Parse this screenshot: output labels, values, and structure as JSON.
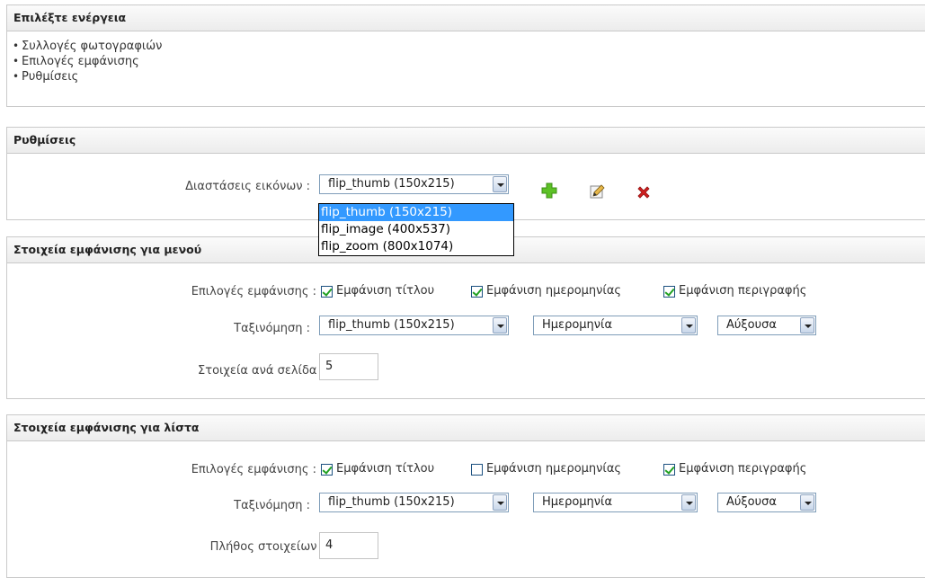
{
  "actions_panel": {
    "title": "Επιλέξτε ενέργεια",
    "items": [
      "Συλλογές φωτογραφιών",
      "Επιλογές εμφάνισης",
      "Ρυθμίσεις"
    ]
  },
  "settings_panel": {
    "title": "Ρυθμίσεις",
    "dimensions_label": "Διαστάσεις εικόνων :",
    "dimensions_selected": "flip_thumb (150x215)",
    "dimensions_options": [
      "flip_thumb (150x215)",
      "flip_image (400x537)",
      "flip_zoom (800x1074)"
    ],
    "tools": [
      "plus-icon",
      "edit-icon",
      "delete-icon"
    ]
  },
  "menu_panel": {
    "title": "Στοιχεία εμφάνισης για μενού",
    "display_label": "Επιλογές εμφάνισης :",
    "checkboxes": [
      {
        "label": "Εμφάνιση τίτλου",
        "checked": true
      },
      {
        "label": "Εμφάνιση ημερομηνίας",
        "checked": true
      },
      {
        "label": "Εμφάνιση περιγραφής",
        "checked": true
      }
    ],
    "sort_label": "Ταξινόμηση :",
    "sort_image": "flip_thumb (150x215)",
    "sort_field": "Ημερομηνία",
    "sort_order": "Αύξουσα",
    "count_label": "Στοιχεία ανά σελίδα :",
    "count_value": "5"
  },
  "list_panel": {
    "title": "Στοιχεία εμφάνισης για λίστα",
    "display_label": "Επιλογές εμφάνισης :",
    "checkboxes": [
      {
        "label": "Εμφάνιση τίτλου",
        "checked": true
      },
      {
        "label": "Εμφάνιση ημερομηνίας",
        "checked": false
      },
      {
        "label": "Εμφάνιση περιγραφής",
        "checked": true
      }
    ],
    "sort_label": "Ταξινόμηση :",
    "sort_image": "flip_thumb (150x215)",
    "sort_field": "Ημερομηνία",
    "sort_order": "Αύξουσα",
    "count_label": "Πλήθος στοιχείων :",
    "count_value": "4"
  },
  "colors": {
    "header_gradient_top": "#fbfbfb",
    "header_gradient_bottom": "#ececec",
    "border": "#c9c9c9",
    "select_highlight": "#3399ff",
    "add_icon": "#5cc126",
    "delete_icon": "#d11f1f"
  }
}
